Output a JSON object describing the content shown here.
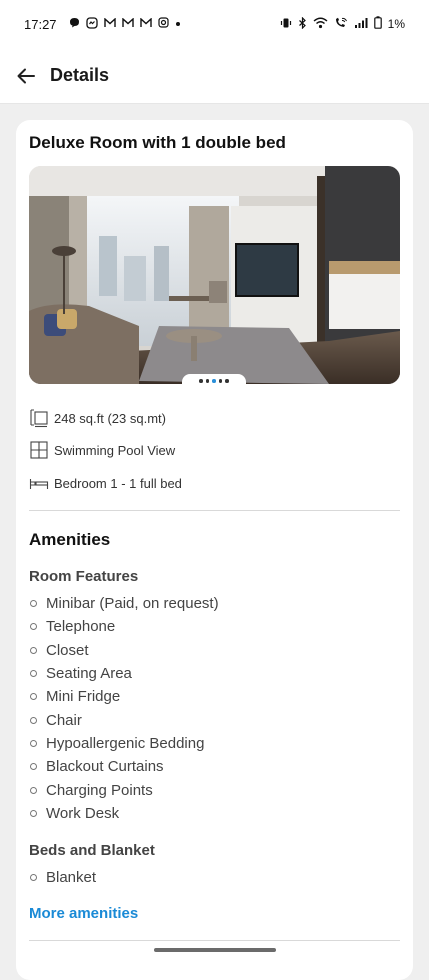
{
  "status_bar": {
    "time": "17:27",
    "battery": "1%",
    "left_icons": [
      "chat-bubble-icon",
      "messenger-icon",
      "gmail-icon",
      "gmail-icon",
      "gmail-icon",
      "instagram-icon",
      "more-dot-icon"
    ],
    "right_icons": [
      "vibrate-icon",
      "bluetooth-icon",
      "wifi-icon",
      "wifi-call-icon",
      "signal-icon",
      "battery-icon"
    ]
  },
  "header": {
    "title": "Details",
    "back_icon": "arrow-left-icon"
  },
  "room": {
    "title": "Deluxe Room with 1 double bed",
    "image_carousel": {
      "total": 5,
      "active_index": 2
    },
    "size": "248 sq.ft (23 sq.mt)",
    "view": "Swimming Pool View",
    "bed": "Bedroom 1 - 1 full bed"
  },
  "amenities": {
    "title": "Amenities",
    "room_features_title": "Room Features",
    "room_features": [
      "Minibar (Paid, on request)",
      "Telephone",
      "Closet",
      "Seating Area",
      "Mini Fridge",
      "Chair",
      "Hypoallergenic Bedding",
      "Blackout Curtains",
      "Charging Points",
      "Work Desk"
    ],
    "beds_title": "Beds and Blanket",
    "beds": [
      "Blanket"
    ],
    "more_label": "More amenities"
  },
  "colors": {
    "accent": "#1a8ad6",
    "background": "#efefef",
    "card": "#ffffff"
  }
}
